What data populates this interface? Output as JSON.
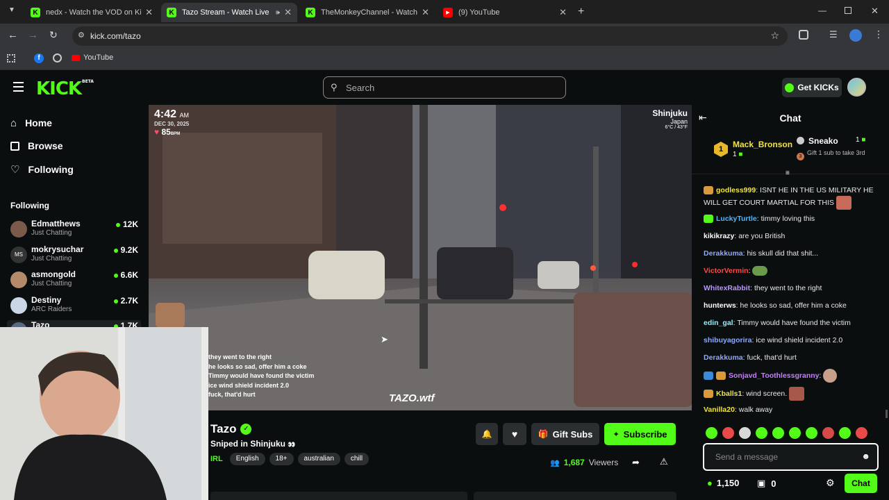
{
  "browser": {
    "tabs": [
      {
        "title": "nedx - Watch the VOD on Kick",
        "favicon": "kick-icon",
        "active": false
      },
      {
        "title": "Tazo Stream - Watch Live on Kick",
        "favicon": "kick-icon",
        "active": true
      },
      {
        "title": "TheMonkeyChannel - Watch the VOD on Kick",
        "favicon": "kick-icon",
        "active": false
      },
      {
        "title": "(9) YouTube",
        "favicon": "youtube-icon",
        "active": false
      }
    ],
    "url": "kick.com/tazo",
    "bookmarks": {
      "youtube": "YouTube"
    }
  },
  "header": {
    "logo": "KICK",
    "beta": "BETA",
    "search_placeholder": "Search",
    "get_kicks": "Get KICKs",
    "brand_color": "#53fc18"
  },
  "sidebar": {
    "nav": [
      {
        "label": "Home",
        "icon": "home-icon"
      },
      {
        "label": "Browse",
        "icon": "browse-icon"
      },
      {
        "label": "Following",
        "icon": "heart-icon"
      }
    ],
    "following_title": "Following",
    "following": [
      {
        "name": "Edmatthews",
        "category": "Just Chatting",
        "viewers": "12K"
      },
      {
        "name": "mokrysuchar",
        "category": "Just Chatting",
        "viewers": "9.2K"
      },
      {
        "name": "asmongold",
        "category": "Just Chatting",
        "viewers": "6.6K"
      },
      {
        "name": "Destiny",
        "category": "ARC Raiders",
        "viewers": "2.7K"
      },
      {
        "name": "Tazo",
        "category": "",
        "viewers": "1.7K"
      }
    ]
  },
  "video": {
    "time": "4:42",
    "ampm": "AM",
    "date": "DEC 30, 2025",
    "bpm": "85",
    "bpm_unit": "BPM",
    "location_city": "Shinjuku",
    "location_country": "Japan",
    "temperature": "6°C / 43°F",
    "overlay_lines": [
      "they went to the right",
      "he looks so sad, offer him a coke",
      "Timmy would have found the victim",
      "ice wind shield incident 2.0",
      "fuck, that'd hurt"
    ],
    "watermark": "TAZO.wtf"
  },
  "stream": {
    "name": "Tazo",
    "title": "Sniped in Shinjuku",
    "category": "IRL",
    "tags": [
      "English",
      "18+",
      "australian",
      "chill"
    ],
    "gift_subs": "Gift Subs",
    "subscribe": "Subscribe",
    "viewers": "1,687",
    "viewers_label": "Viewers"
  },
  "chat": {
    "title": "Chat",
    "leaders": [
      {
        "rank": "1",
        "name": "Mack_Bronson",
        "count": "1"
      },
      {
        "rank": "3",
        "name": "Sneako",
        "count": "1",
        "note": "Gift 1 sub to take 3rd"
      }
    ],
    "messages": [
      {
        "user": "godless999",
        "color": "#f0e442",
        "text": "ISNT HE IN THE US MILITARY HE WILL GET COURT MARTIAL FOR THIS"
      },
      {
        "user": "LuckyTurtle",
        "color": "#4db6ff",
        "text": "timmy loving this"
      },
      {
        "user": "kikikrazy",
        "color": "#ffffff",
        "text": "are you British"
      },
      {
        "user": "Derakkuma",
        "color": "#8fa8ff",
        "text": "his skull did that shit..."
      },
      {
        "user": "VictorVermin",
        "color": "#ff4a4a",
        "text": ""
      },
      {
        "user": "WhitexRabbit",
        "color": "#b996ff",
        "text": "they went to the right"
      },
      {
        "user": "hunterws",
        "color": "#ffffff",
        "text": "he looks so sad, offer him a coke"
      },
      {
        "user": "edin_gal",
        "color": "#8df0ff",
        "text": "Timmy would have found the victim"
      },
      {
        "user": "shibuyagorira",
        "color": "#8fa8ff",
        "text": "ice wind shield incident 2.0"
      },
      {
        "user": "Derakkuma",
        "color": "#8fa8ff",
        "text": "fuck, that'd hurt"
      },
      {
        "user": "Sonjavd_Toothlessgranny",
        "color": "#c87dff",
        "text": ""
      },
      {
        "user": "Kballs1",
        "color": "#f0e442",
        "text": "wind screen."
      },
      {
        "user": "Vanilla20",
        "color": "#f0e442",
        "text": "walk away"
      }
    ],
    "input_placeholder": "Send a message",
    "points": "1,150",
    "gift_count": "0",
    "send": "Chat"
  }
}
